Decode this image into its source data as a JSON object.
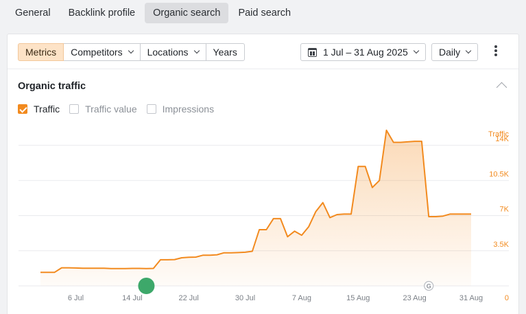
{
  "tabs": [
    {
      "label": "General"
    },
    {
      "label": "Backlink profile"
    },
    {
      "label": "Organic search",
      "active": true
    },
    {
      "label": "Paid search"
    }
  ],
  "toolbar": {
    "segments": [
      "Metrics",
      "Competitors",
      "Locations",
      "Years"
    ],
    "date_range": "1 Jul – 31 Aug 2025",
    "granularity": "Daily"
  },
  "section": {
    "title": "Organic traffic",
    "checkboxes": [
      {
        "label": "Traffic",
        "checked": true
      },
      {
        "label": "Traffic value",
        "checked": false
      },
      {
        "label": "Impressions",
        "checked": false
      }
    ]
  },
  "colors": {
    "accent": "#f28a1e",
    "marker": "#3da86a"
  },
  "chart_data": {
    "type": "area",
    "ylabel": "Traffic",
    "y_ticks": [
      "14K",
      "10.5K",
      "7K",
      "3.5K",
      "0"
    ],
    "y_tick_values": [
      14000,
      10500,
      7000,
      3500,
      0
    ],
    "ylim": [
      0,
      14000
    ],
    "x_ticks": [
      "6 Jul",
      "14 Jul",
      "22 Jul",
      "30 Jul",
      "7 Aug",
      "15 Aug",
      "23 Aug",
      "31 Aug"
    ],
    "x_tick_days": [
      6,
      14,
      22,
      30,
      38,
      46,
      54,
      62
    ],
    "x_range_days": [
      1,
      62
    ],
    "grid": true,
    "series": [
      {
        "x": [
          1,
          2,
          3,
          4,
          5,
          6,
          7,
          8,
          9,
          10,
          11,
          12,
          13,
          14,
          15,
          16,
          17,
          18,
          19,
          20,
          21,
          22,
          23,
          24,
          25,
          26,
          27,
          28,
          29,
          30,
          31,
          32,
          33,
          34,
          35,
          36,
          37,
          38,
          39,
          40,
          41,
          42,
          43,
          44,
          45,
          46,
          47,
          48,
          49,
          50,
          51,
          52,
          53,
          54,
          55,
          56,
          57,
          58,
          59,
          60,
          61,
          62
        ],
        "values": [
          1350,
          1350,
          1350,
          1800,
          1800,
          1780,
          1760,
          1760,
          1760,
          1760,
          1720,
          1720,
          1730,
          1740,
          1740,
          1720,
          1740,
          2600,
          2600,
          2620,
          2800,
          2850,
          2870,
          3050,
          3050,
          3100,
          3300,
          3300,
          3320,
          3350,
          3450,
          5600,
          5600,
          6700,
          6700,
          4900,
          5450,
          5050,
          5900,
          7400,
          8300,
          6800,
          7100,
          7150,
          7150,
          11900,
          11900,
          9800,
          10500,
          15500,
          14300,
          14300,
          14350,
          14400,
          14400,
          6900,
          6900,
          6950,
          7150,
          7150,
          7150,
          7150
        ]
      }
    ],
    "annotation_markers": [
      {
        "type": "event",
        "day": 16
      },
      {
        "type": "google-update",
        "label": "G",
        "day": 56
      }
    ]
  }
}
